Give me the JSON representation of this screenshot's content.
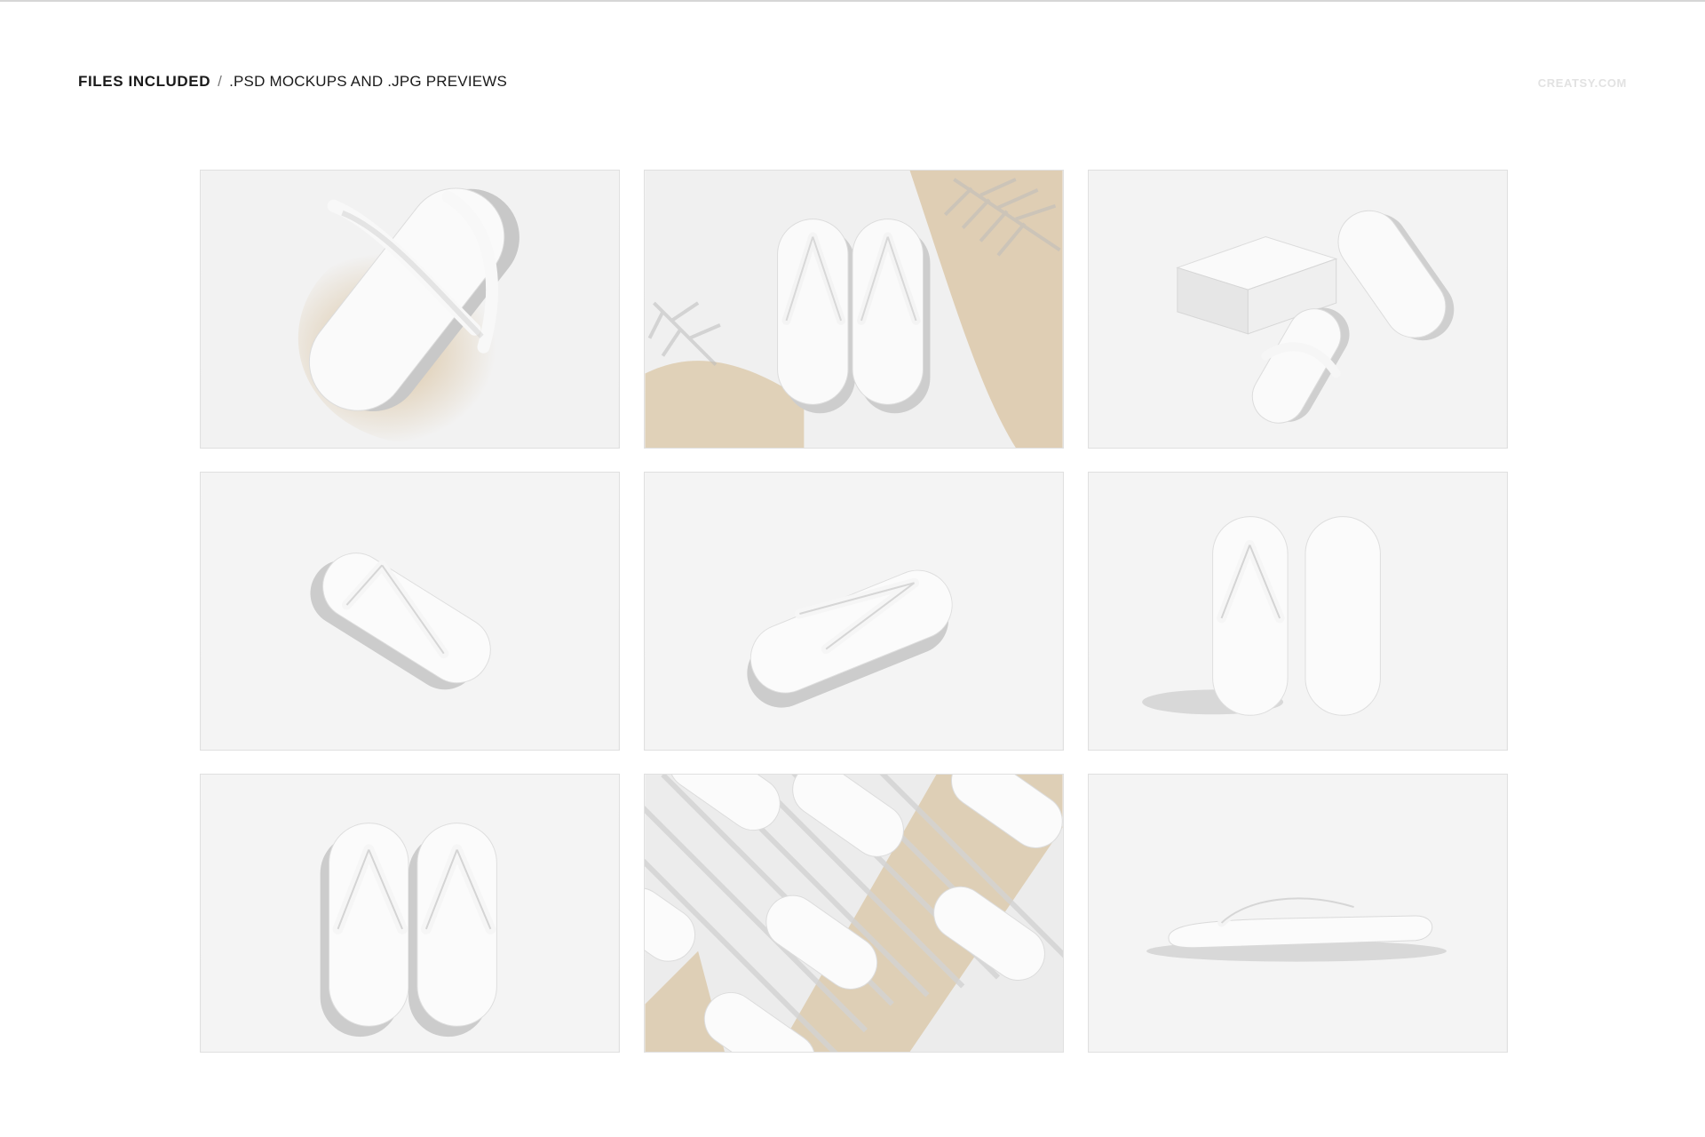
{
  "header": {
    "title": "FILES INCLUDED",
    "separator": "/",
    "subtitle": ".PSD MOCKUPS AND .JPG PREVIEWS"
  },
  "brand": "CREATSY.COM",
  "colors": {
    "background": "#ffffff",
    "sand": "#d9c3a0",
    "surface": "#efefef",
    "sandal": "#fbfbfb",
    "shadow": "#c9c9c9"
  },
  "previews": [
    {
      "id": "preview-1",
      "scene": "flip-flop-tilted-on-sand"
    },
    {
      "id": "preview-2",
      "scene": "pair-with-palm-shadows-and-sand"
    },
    {
      "id": "preview-3",
      "scene": "flip-flops-with-box"
    },
    {
      "id": "preview-4",
      "scene": "single-angled-left"
    },
    {
      "id": "preview-5",
      "scene": "single-angled-right"
    },
    {
      "id": "preview-6",
      "scene": "pair-top-and-bottom-view"
    },
    {
      "id": "preview-7",
      "scene": "pair-top-view"
    },
    {
      "id": "preview-8",
      "scene": "pattern-with-stripe-shadows-and-sand"
    },
    {
      "id": "preview-9",
      "scene": "side-view"
    }
  ]
}
